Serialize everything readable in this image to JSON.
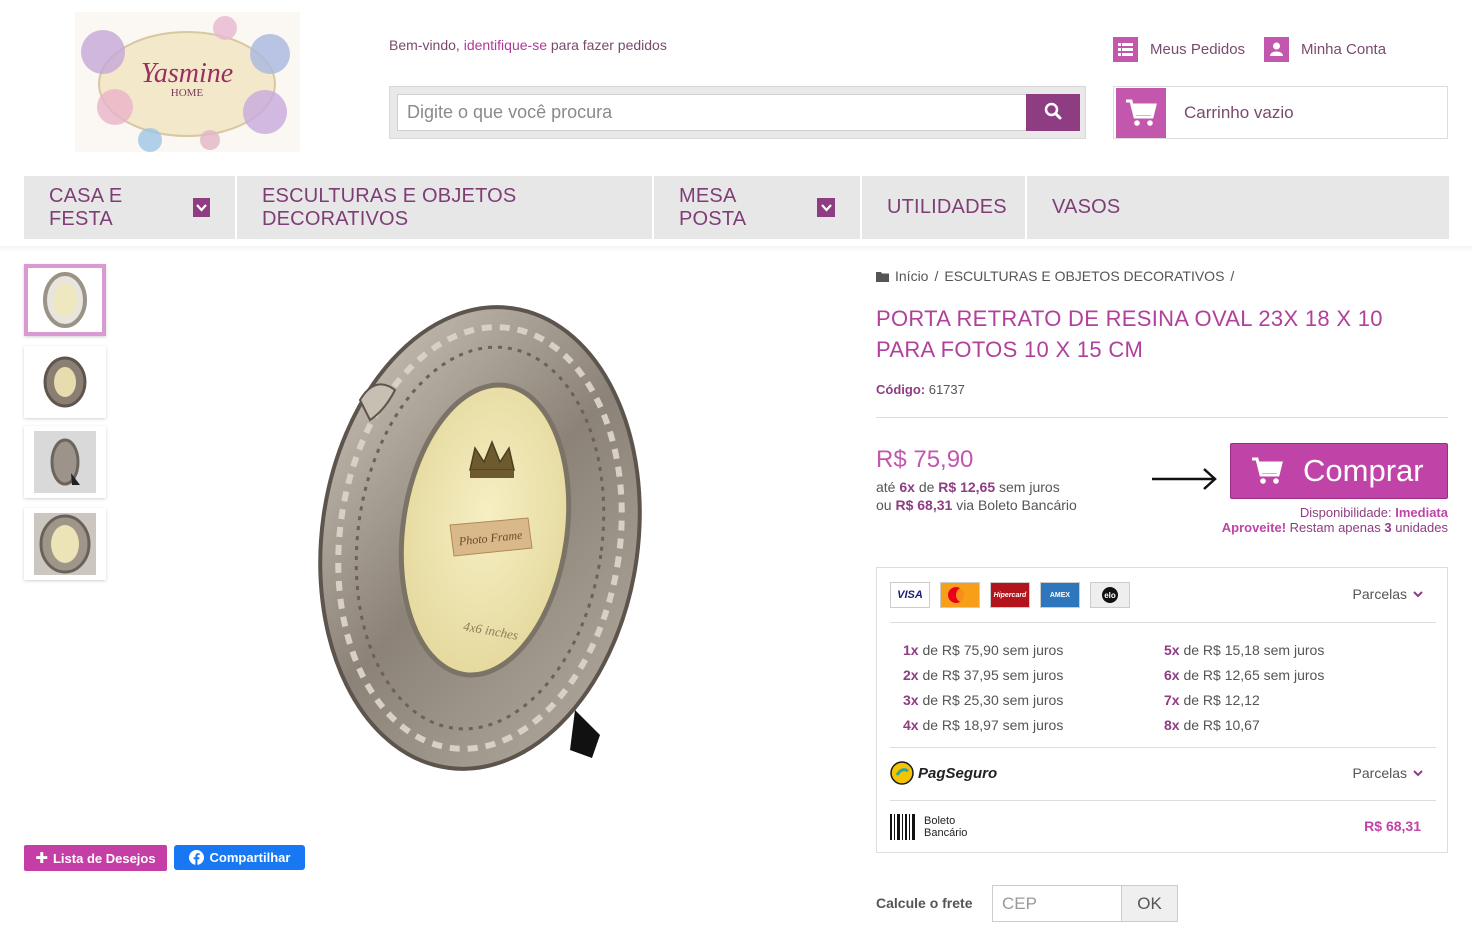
{
  "header": {
    "logo_text": "Yasmine",
    "logo_sub": "HOME",
    "welcome_prefix": "Bem-vindo,",
    "welcome_link": "identifique-se",
    "welcome_suffix": "para fazer pedidos",
    "search_placeholder": "Digite o que você procura",
    "my_orders": "Meus Pedidos",
    "my_account": "Minha Conta",
    "cart": "Carrinho vazio"
  },
  "nav": [
    {
      "label": "CASA E FESTA",
      "dropdown": true
    },
    {
      "label": "ESCULTURAS E OBJETOS DECORATIVOS",
      "dropdown": false
    },
    {
      "label": "MESA POSTA",
      "dropdown": true
    },
    {
      "label": "UTILIDADES",
      "dropdown": false
    },
    {
      "label": "VASOS",
      "dropdown": false
    }
  ],
  "breadcrumb": [
    "Início",
    "ESCULTURAS E OBJETOS DECORATIVOS"
  ],
  "product": {
    "title": "PORTA RETRATO DE RESINA OVAL 23X 18 X 10 PARA FOTOS 10 X 15 CM",
    "code_label": "Código:",
    "code": "61737",
    "price": "R$ 75,90",
    "inst_prefix": "até",
    "inst_count": "6x",
    "inst_de": "de",
    "inst_value": "R$ 12,65",
    "inst_suffix": "sem juros",
    "boleto_prefix": "ou",
    "boleto_value": "R$ 68,31",
    "boleto_suffix": "via Boleto Bancário",
    "buy": "Comprar",
    "availability_label": "Disponibilidade:",
    "availability_value": "Imediata",
    "stock_prefix": "Aproveite!",
    "stock_mid": "Restam apenas",
    "stock_count": "3",
    "stock_suffix": "unidades",
    "frame_text": "Photo Frame",
    "frame_size": "4x6 inches"
  },
  "actions": {
    "wishlist": "Lista de Desejos",
    "share": "Compartilhar"
  },
  "payment": {
    "cards": [
      {
        "label": "VISA",
        "color": "#1a1f71"
      },
      {
        "label": "Master",
        "color": "#eb001b"
      },
      {
        "label": "Hipercard",
        "color": "#b3131b"
      },
      {
        "label": "AMEX",
        "color": "#2e77bc"
      },
      {
        "label": "elo",
        "color": "#000000"
      }
    ],
    "parcelas_label": "Parcelas",
    "installments_left": [
      {
        "n": "1x",
        "text": "de R$ 75,90 sem juros"
      },
      {
        "n": "2x",
        "text": "de R$ 37,95 sem juros"
      },
      {
        "n": "3x",
        "text": "de R$ 25,30 sem juros"
      },
      {
        "n": "4x",
        "text": "de R$ 18,97 sem juros"
      }
    ],
    "installments_right": [
      {
        "n": "5x",
        "text": "de R$ 15,18 sem juros"
      },
      {
        "n": "6x",
        "text": "de R$ 12,65 sem juros"
      },
      {
        "n": "7x",
        "text": "de R$ 12,12"
      },
      {
        "n": "8x",
        "text": "de R$ 10,67"
      }
    ],
    "pagseguro": "PagSeguro",
    "pagseguro_parcelas": "Parcelas",
    "boleto_line1": "Boleto",
    "boleto_line2": "Bancário",
    "boleto_price": "R$ 68,31"
  },
  "shipping": {
    "label": "Calcule o frete",
    "placeholder": "CEP",
    "ok": "OK"
  },
  "colors": {
    "accent": "#c257ad",
    "dark_accent": "#8e3d82",
    "title": "#b0409b"
  }
}
